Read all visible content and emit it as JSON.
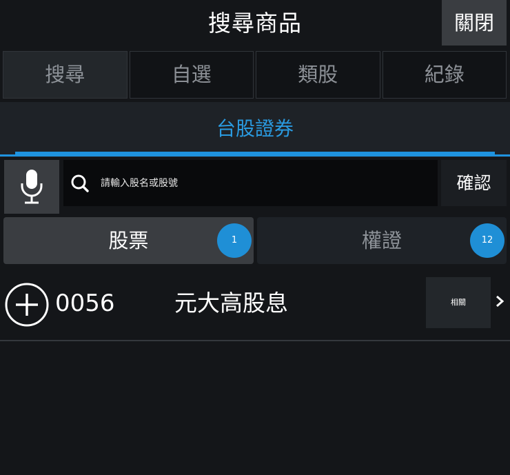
{
  "header": {
    "title": "搜尋商品",
    "close_label": "關閉"
  },
  "tabs": [
    {
      "label": "搜尋",
      "active": true
    },
    {
      "label": "自選",
      "active": false
    },
    {
      "label": "類股",
      "active": false
    },
    {
      "label": "紀錄",
      "active": false
    }
  ],
  "market": {
    "label": "台股證券"
  },
  "search": {
    "placeholder": "請輸入股名或股號",
    "value": "",
    "confirm_label": "確認"
  },
  "segments": {
    "stock": {
      "label": "股票",
      "count": "1"
    },
    "warrant": {
      "label": "權證",
      "count": "12"
    }
  },
  "results": [
    {
      "code": "0056",
      "name": "元大高股息",
      "related_label": "相關"
    }
  ],
  "colors": {
    "accent": "#1f93df",
    "badge": "#1f8fd6",
    "background": "#141619"
  },
  "icons": {
    "mic": "microphone-icon",
    "search": "search-icon",
    "add": "plus-circle-icon",
    "more": "chevron-right-icon"
  }
}
